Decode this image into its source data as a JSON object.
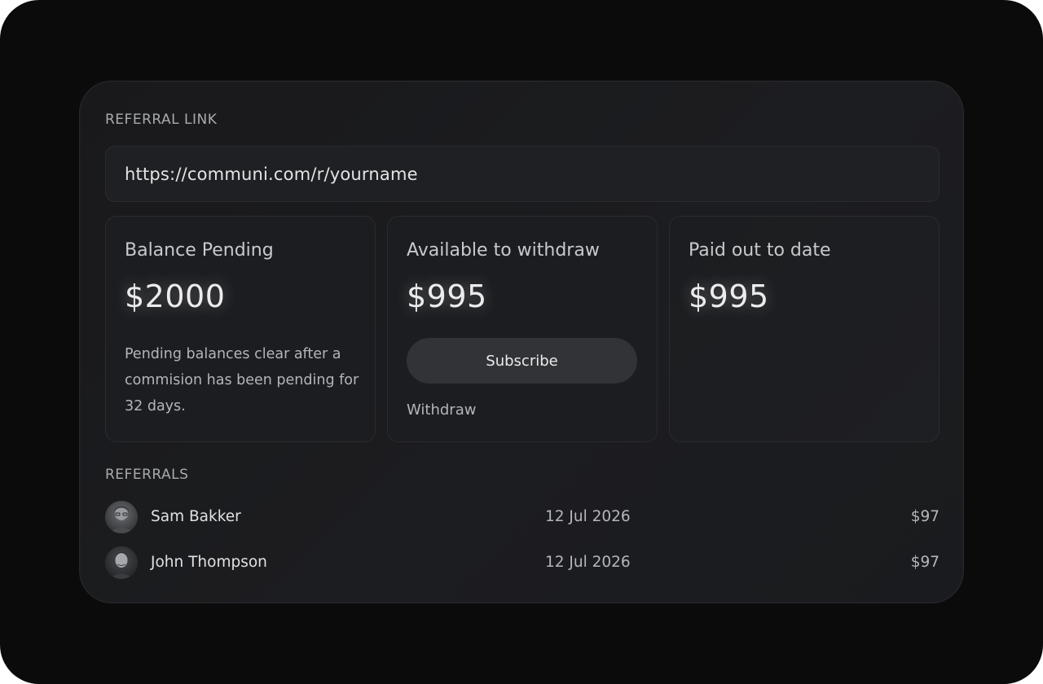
{
  "referral_link": {
    "label": "REFERRAL LINK",
    "url": "https://communi.com/r/yourname"
  },
  "stats": [
    {
      "title": "Balance Pending",
      "value": "$2000",
      "note": "Pending balances clear after a commision has been pending for 32 days."
    },
    {
      "title": "Available to withdraw",
      "value": "$995",
      "button_label": "Subscribe",
      "link_label": "Withdraw"
    },
    {
      "title": "Paid out to date",
      "value": "$995"
    }
  ],
  "referrals": {
    "label": "REFERRALS",
    "rows": [
      {
        "name": "Sam Bakker",
        "date": "12 Jul 2026",
        "amount": "$97",
        "avatar": "person-avatar-icon"
      },
      {
        "name": "John Thompson",
        "date": "12 Jul 2026",
        "amount": "$97",
        "avatar": "person-avatar-icon"
      }
    ]
  },
  "colors": {
    "background": "#0b0b0c",
    "card": "#1a1b1e",
    "button": "#323336",
    "text_primary": "#ececee",
    "text_secondary": "#b4b5b8"
  }
}
